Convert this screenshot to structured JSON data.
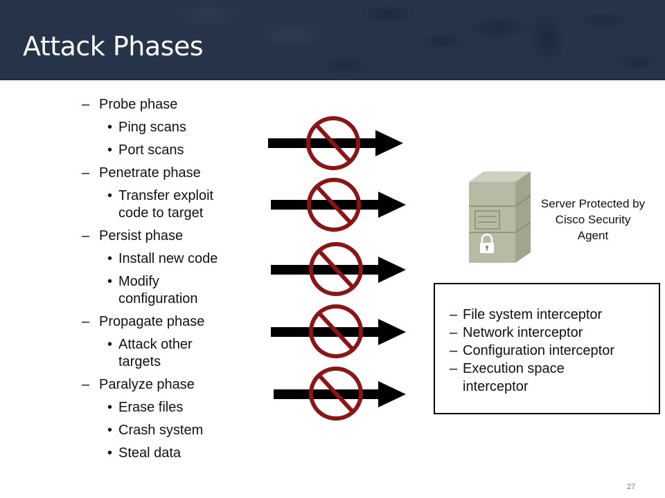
{
  "slide": {
    "title": "Attack Phases",
    "page_number": "27",
    "colors": {
      "header_bg": "#263449",
      "title_text": "#ffffff",
      "prohibit_red": "#8b1414",
      "arrow": "#000000",
      "server_body": "#b9baa6"
    }
  },
  "outline": {
    "dash": "–",
    "bullet": "•",
    "phases": [
      {
        "label": "Probe phase",
        "items": [
          "Ping scans",
          "Port scans"
        ]
      },
      {
        "label": "Penetrate phase",
        "items": [
          "Transfer exploit code to target"
        ]
      },
      {
        "label": "Persist phase",
        "items": [
          "Install new code",
          "Modify configuration"
        ]
      },
      {
        "label": "Propagate phase",
        "items": [
          "Attack other targets"
        ]
      },
      {
        "label": "Paralyze phase",
        "items": [
          "Erase files",
          "Crash system",
          "Steal data"
        ]
      }
    ]
  },
  "diagram": {
    "blocked_arrows": 5,
    "arrow_icon": "blocked-arrow-icon",
    "server_icon": "locked-server-icon",
    "server_label": "Server Protected by Cisco Security Agent"
  },
  "interceptors": {
    "dash": "–",
    "items": [
      "File system interceptor",
      "Network interceptor",
      "Configuration interceptor",
      "Execution space interceptor"
    ]
  }
}
